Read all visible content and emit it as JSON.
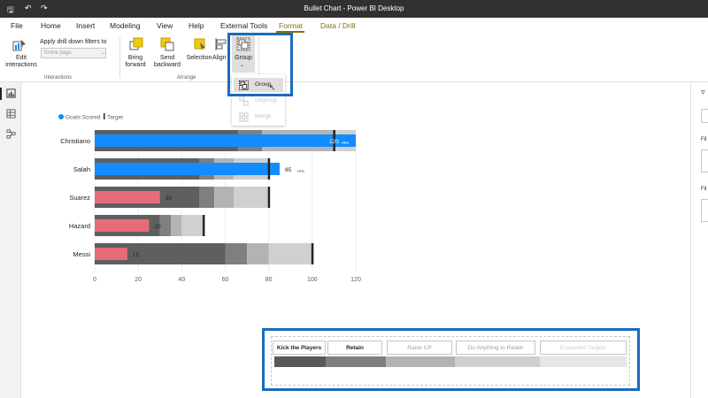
{
  "window": {
    "title": "Bullet Chart - Power BI Desktop"
  },
  "menu": [
    "File",
    "Home",
    "Insert",
    "Modeling",
    "View",
    "Help",
    "External Tools",
    "Format",
    "Data / Drill"
  ],
  "ribbon": {
    "edit_interactions": "Edit interactions",
    "apply_drill": "Apply drill down filters to",
    "drill_placeholder": "Entire page",
    "interactions_group": "Interactions",
    "bring_forward": "Bring forward",
    "send_backward": "Send backward",
    "selection": "Selection",
    "align": "Align",
    "group": "Group",
    "arrange_group": "Arrange"
  },
  "group_menu": {
    "items": [
      {
        "label": "Group",
        "enabled": true
      },
      {
        "label": "Ungroup",
        "enabled": false
      },
      {
        "label": "Merge",
        "enabled": false
      }
    ]
  },
  "right_pane": {
    "label1": "Fil",
    "label2": "Fil"
  },
  "chart_data": {
    "type": "bar",
    "legend": [
      "Goals Scored",
      "Target"
    ],
    "categories": [
      "Christiano",
      "Salah",
      "Suarez",
      "Hazard",
      "Messi"
    ],
    "series": [
      {
        "name": "Goals Scored",
        "values": [
          120,
          85,
          30,
          25,
          15
        ]
      }
    ],
    "targets": [
      110,
      80,
      80,
      50,
      100
    ],
    "bands": [
      [
        66,
        77,
        110,
        120
      ],
      [
        48,
        55,
        64,
        80
      ],
      [
        48,
        55,
        64,
        80
      ],
      [
        30,
        35,
        40,
        50
      ],
      [
        60,
        70,
        80,
        100
      ]
    ],
    "value_labels": [
      "120",
      "85",
      "30",
      "25",
      "15"
    ],
    "variance_labels": [
      "+9%",
      "+6%",
      "",
      "",
      ""
    ],
    "xlim": [
      0,
      120
    ],
    "xticks": [
      "0",
      "20",
      "40",
      "60",
      "80",
      "100",
      "120"
    ],
    "colors": {
      "above": "#118dff",
      "below": "#e66c7a",
      "target": "#252423"
    }
  },
  "slicer": {
    "buttons": [
      "Kick the Players",
      "Retain",
      "Raise CP",
      "Do Anything to Retain",
      "Exceeded Targets"
    ]
  },
  "colors": {
    "highlight": "#1a6bbf",
    "titlebar": "#323130",
    "accent": "#8a6d0b"
  }
}
